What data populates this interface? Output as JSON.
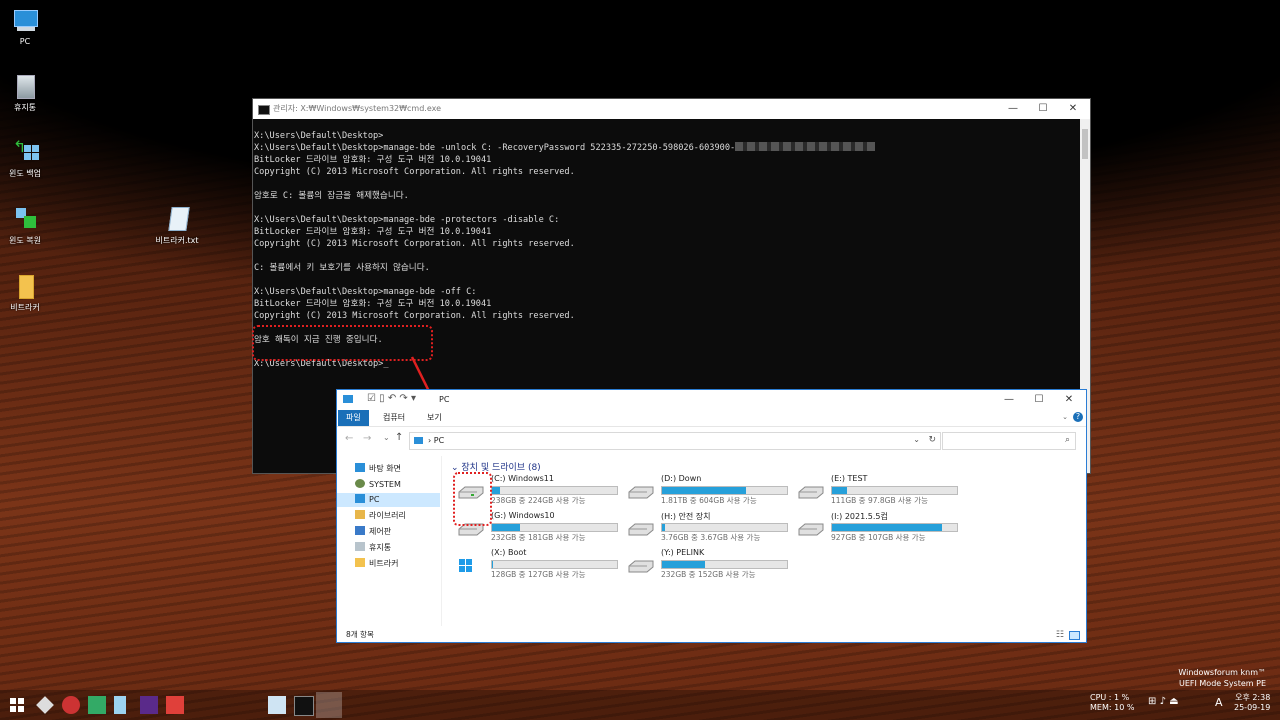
{
  "desktop": {
    "icons": [
      {
        "label": "PC"
      },
      {
        "label": "휴지통"
      },
      {
        "label": "윈도 백업"
      },
      {
        "label": "윈도 복원"
      },
      {
        "label": "비트라커"
      },
      {
        "label": "비트라커.txt"
      }
    ]
  },
  "cmd": {
    "title": "관리자: X:₩Windows₩system32₩cmd.exe",
    "lines": [
      "X:\\Users\\Default\\Desktop>",
      "X:\\Users\\Default\\Desktop>manage-bde -unlock C: -RecoveryPassword 522335-272250-598026-603900-",
      "BitLocker 드라이브 암호화: 구성 도구 버전 10.0.19041",
      "Copyright (C) 2013 Microsoft Corporation. All rights reserved.",
      "",
      "암호로 C: 볼륨의 잠금을 해제했습니다.",
      "",
      "X:\\Users\\Default\\Desktop>manage-bde -protectors -disable C:",
      "BitLocker 드라이브 암호화: 구성 도구 버전 10.0.19041",
      "Copyright (C) 2013 Microsoft Corporation. All rights reserved.",
      "",
      "C: 볼륨에서 키 보호기를 사용하지 않습니다.",
      "",
      "X:\\Users\\Default\\Desktop>manage-bde -off C:",
      "BitLocker 드라이브 암호화: 구성 도구 버전 10.0.19041",
      "Copyright (C) 2013 Microsoft Corporation. All rights reserved.",
      "",
      "",
      "암호 해독이 지금 진행 중입니다.",
      "",
      "X:\\Users\\Default\\Desktop>_"
    ]
  },
  "explorer": {
    "title": "PC",
    "tabs": [
      "파일",
      "컴퓨터",
      "보기"
    ],
    "address": "PC",
    "nav": [
      "바탕 화면",
      "SYSTEM",
      "PC",
      "라이브러리",
      "제어판",
      "휴지통",
      "비트라커"
    ],
    "group": "장치 및 드라이브 (8)",
    "drives": [
      {
        "name": "(C:) Windows11",
        "free": "238GB 중 224GB 사용 가능",
        "fill": 0.06
      },
      {
        "name": "(D:) Down",
        "free": "1.81TB 중 604GB 사용 가능",
        "fill": 0.67
      },
      {
        "name": "(E:) TEST",
        "free": "111GB 중 97.8GB 사용 가능",
        "fill": 0.12
      },
      {
        "name": "(G:) Windows10",
        "free": "232GB 중 181GB 사용 가능",
        "fill": 0.22
      },
      {
        "name": "(H:) 안전 장치",
        "free": "3.76GB 중 3.67GB 사용 가능",
        "fill": 0.02
      },
      {
        "name": "(I:) 2021.5.5컴",
        "free": "927GB 중 107GB 사용 가능",
        "fill": 0.88
      },
      {
        "name": "(X:) Boot",
        "free": "128GB 중 127GB 사용 가능",
        "fill": 0.01
      },
      {
        "name": "(Y:) PELINK",
        "free": "232GB 중 152GB 사용 가능",
        "fill": 0.34
      }
    ],
    "status": "8개 항목"
  },
  "watermark": {
    "line1": "Windowsforum knm™",
    "line2": "UEFI Mode System PE"
  },
  "tray": {
    "cpu": "CPU :   1 %",
    "mem": "MEM: 10 %",
    "time": "오후 2:38",
    "date": "25-09-19",
    "ime": "A"
  },
  "colors": {
    "accent": "#1a6fb8",
    "bar": "#26a0da",
    "highlight": "#e02020"
  }
}
